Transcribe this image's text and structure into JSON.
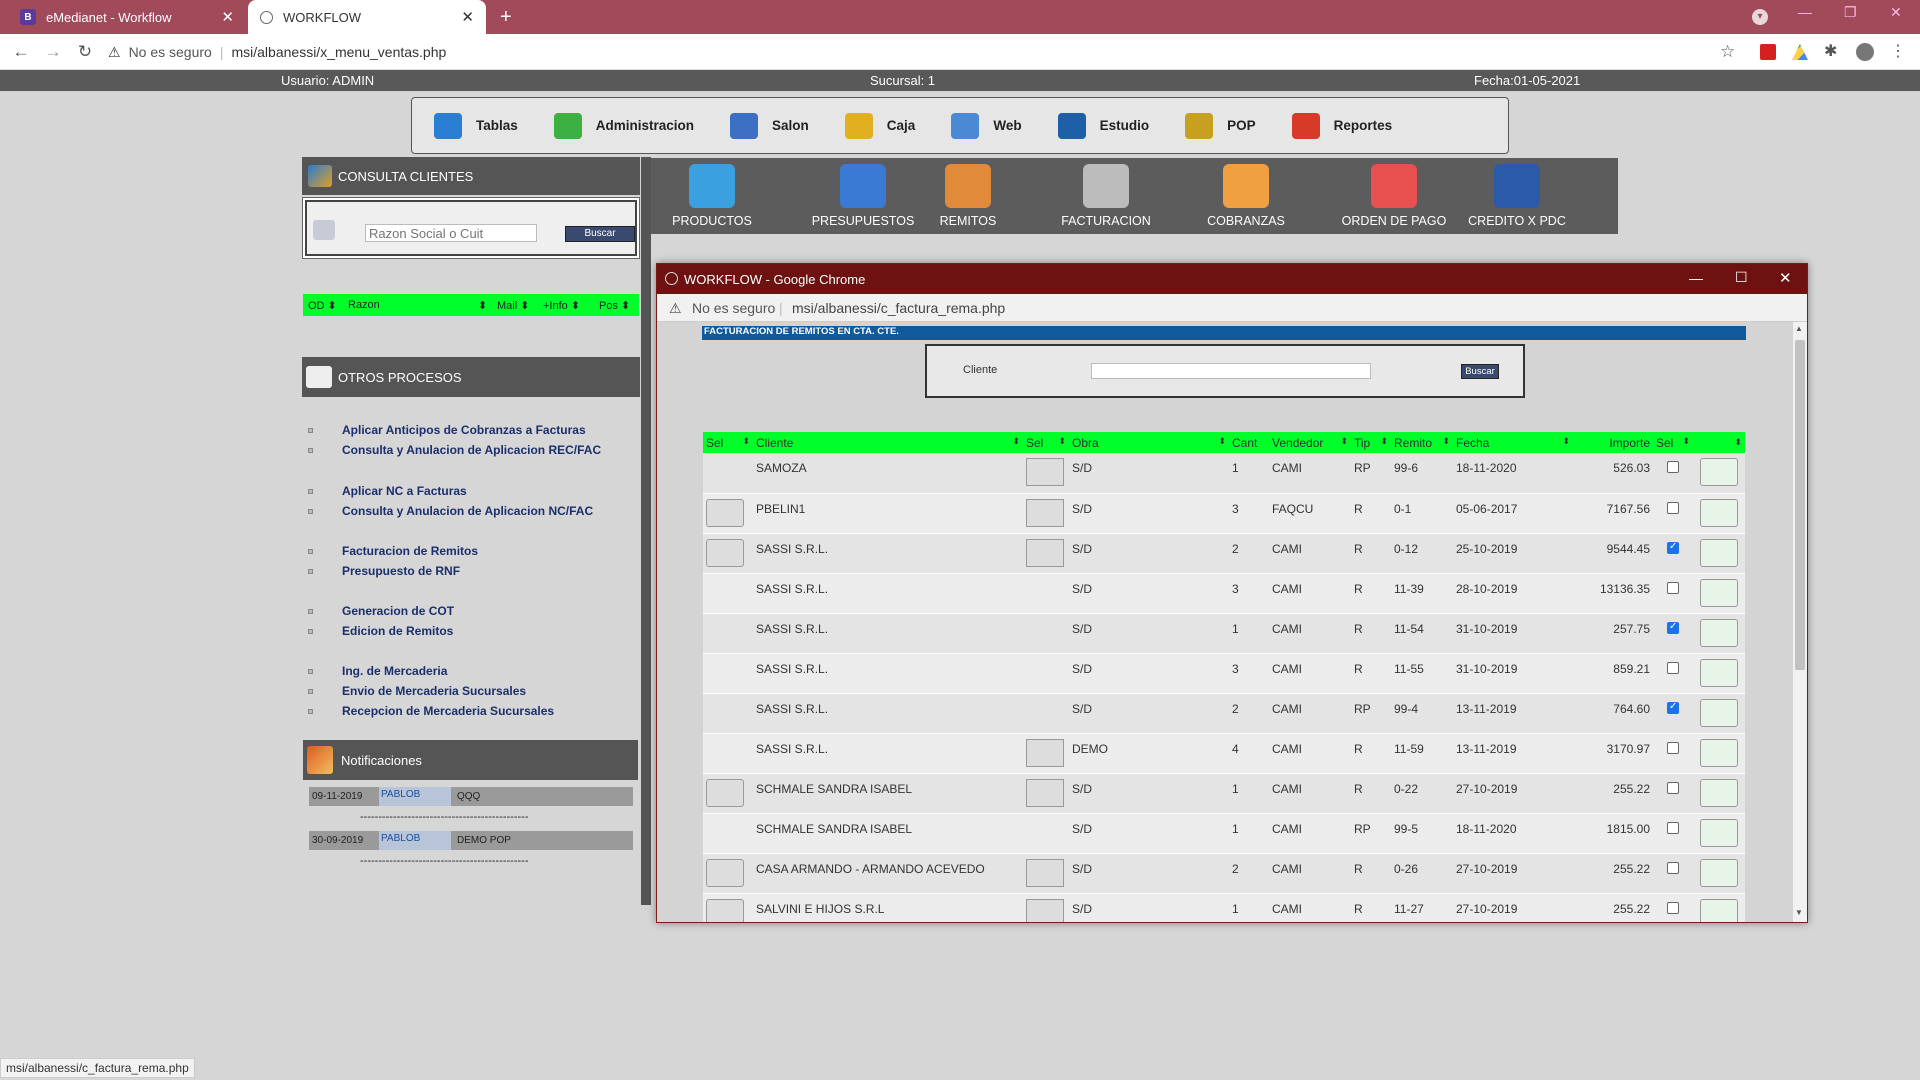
{
  "browser": {
    "tabs": [
      {
        "label": "eMedianet - Workflow",
        "favicon": "B"
      },
      {
        "label": "WORKFLOW"
      }
    ],
    "security": "No es seguro",
    "url": "msi/albanessi/x_menu_ventas.php"
  },
  "header": {
    "usuario": "Usuario: ADMIN",
    "sucursal": "Sucursal: 1",
    "fecha": "Fecha:01-05-2021"
  },
  "menu": [
    {
      "label": "Tablas",
      "icon": "table-icon",
      "color": "#2a7fd4"
    },
    {
      "label": "Administracion",
      "icon": "checklist-icon",
      "color": "#3cb043"
    },
    {
      "label": "Salon",
      "icon": "globe-icon",
      "color": "#3a6fc4"
    },
    {
      "label": "Caja",
      "icon": "cashbox-icon",
      "color": "#e0b020"
    },
    {
      "label": "Web",
      "icon": "search-people-icon",
      "color": "#4a8ad4"
    },
    {
      "label": "Estudio",
      "icon": "book-icon",
      "color": "#1f5fa8"
    },
    {
      "label": "POP",
      "icon": "users-chart-icon",
      "color": "#c8a020"
    },
    {
      "label": "Reportes",
      "icon": "pie-chart-icon",
      "color": "#d83a2a"
    }
  ],
  "consulta": {
    "title": "CONSULTA CLIENTES",
    "placeholder": "Razon Social o Cuit",
    "buscar": "Buscar",
    "columns": [
      "OD",
      "Razon",
      "Mail",
      "+Info",
      "Pos"
    ]
  },
  "otros": {
    "title": "OTROS PROCESOS",
    "groups": [
      [
        "Aplicar Anticipos de Cobranzas a Facturas",
        "Consulta y Anulacion de Aplicacion REC/FAC"
      ],
      [
        "Aplicar NC a Facturas",
        "Consulta y Anulacion de Aplicacion NC/FAC"
      ],
      [
        "Facturacion de Remitos",
        "Presupuesto de RNF"
      ],
      [
        "Generacion de COT",
        "Edicion de Remitos"
      ],
      [
        "Ing. de Mercaderia",
        "Envio de Mercaderia Sucursales",
        "Recepcion de Mercaderia Sucursales"
      ]
    ]
  },
  "notificaciones": {
    "title": "Notificaciones",
    "items": [
      {
        "fecha": "09-11-2019",
        "user": "PABLOB",
        "msg": "QQQ"
      },
      {
        "fecha": "30-09-2019",
        "user": "PABLOB",
        "msg": "DEMO POP"
      }
    ],
    "separator": "----------------------------------------------"
  },
  "toolbar": [
    {
      "label": "PRODUCTOS",
      "color": "#3aa0e0"
    },
    {
      "label": "PRESUPUESTOS",
      "color": "#3a7ad4"
    },
    {
      "label": "REMITOS",
      "color": "#e08a3a"
    },
    {
      "label": "FACTURACION",
      "color": "#bcbcbc"
    },
    {
      "label": "COBRANZAS",
      "color": "#f0a040"
    },
    {
      "label": "ORDEN DE PAGO",
      "color": "#e85050"
    },
    {
      "label": "CREDITO X PDC",
      "color": "#2a5aa8"
    }
  ],
  "popup": {
    "title": "WORKFLOW - Google Chrome",
    "security": "No es seguro",
    "url": "msi/albanessi/c_factura_rema.php",
    "banner": "FACTURACION DE REMITOS EN CTA. CTE.",
    "cliente_label": "Cliente",
    "buscar": "Buscar",
    "columns": [
      "Sel",
      "Cliente",
      "Sel",
      "Obra",
      "Cant",
      "Vendedor",
      "Tip",
      "Remito",
      "Fecha",
      "Importe",
      "Sel",
      ""
    ],
    "rows": [
      {
        "btn1": false,
        "cliente": "SAMOZA",
        "btn2": true,
        "obra": "S/D",
        "cant": "1",
        "vendedor": "CAMI",
        "tip": "RP",
        "remito": "99-6",
        "fecha": "18-11-2020",
        "importe": "526.03",
        "checked": false
      },
      {
        "btn1": true,
        "cliente": "PBELIN1",
        "btn2": true,
        "obra": "S/D",
        "cant": "3",
        "vendedor": "FAQCU",
        "tip": "R",
        "remito": "0-1",
        "fecha": "05-06-2017",
        "importe": "7167.56",
        "checked": false
      },
      {
        "btn1": true,
        "cliente": "SASSI S.R.L.",
        "btn2": true,
        "obra": "S/D",
        "cant": "2",
        "vendedor": "CAMI",
        "tip": "R",
        "remito": "0-12",
        "fecha": "25-10-2019",
        "importe": "9544.45",
        "checked": true
      },
      {
        "btn1": false,
        "cliente": "SASSI S.R.L.",
        "btn2": false,
        "obra": "S/D",
        "cant": "3",
        "vendedor": "CAMI",
        "tip": "R",
        "remito": "11-39",
        "fecha": "28-10-2019",
        "importe": "13136.35",
        "checked": false
      },
      {
        "btn1": false,
        "cliente": "SASSI S.R.L.",
        "btn2": false,
        "obra": "S/D",
        "cant": "1",
        "vendedor": "CAMI",
        "tip": "R",
        "remito": "11-54",
        "fecha": "31-10-2019",
        "importe": "257.75",
        "checked": true
      },
      {
        "btn1": false,
        "cliente": "SASSI S.R.L.",
        "btn2": false,
        "obra": "S/D",
        "cant": "3",
        "vendedor": "CAMI",
        "tip": "R",
        "remito": "11-55",
        "fecha": "31-10-2019",
        "importe": "859.21",
        "checked": false
      },
      {
        "btn1": false,
        "cliente": "SASSI S.R.L.",
        "btn2": false,
        "obra": "S/D",
        "cant": "2",
        "vendedor": "CAMI",
        "tip": "RP",
        "remito": "99-4",
        "fecha": "13-11-2019",
        "importe": "764.60",
        "checked": true
      },
      {
        "btn1": false,
        "cliente": "SASSI S.R.L.",
        "btn2": true,
        "obra": "DEMO",
        "cant": "4",
        "vendedor": "CAMI",
        "tip": "R",
        "remito": "11-59",
        "fecha": "13-11-2019",
        "importe": "3170.97",
        "checked": false
      },
      {
        "btn1": true,
        "cliente": "SCHMALE SANDRA ISABEL",
        "btn2": true,
        "obra": "S/D",
        "cant": "1",
        "vendedor": "CAMI",
        "tip": "R",
        "remito": "0-22",
        "fecha": "27-10-2019",
        "importe": "255.22",
        "checked": false
      },
      {
        "btn1": false,
        "cliente": "SCHMALE SANDRA ISABEL",
        "btn2": false,
        "obra": "S/D",
        "cant": "1",
        "vendedor": "CAMI",
        "tip": "RP",
        "remito": "99-5",
        "fecha": "18-11-2020",
        "importe": "1815.00",
        "checked": false
      },
      {
        "btn1": true,
        "cliente": "CASA ARMANDO - ARMANDO ACEVEDO",
        "btn2": true,
        "obra": "S/D",
        "cant": "2",
        "vendedor": "CAMI",
        "tip": "R",
        "remito": "0-26",
        "fecha": "27-10-2019",
        "importe": "255.22",
        "checked": false
      },
      {
        "btn1": true,
        "cliente": "SALVINI E HIJOS S.R.L",
        "btn2": true,
        "obra": "S/D",
        "cant": "1",
        "vendedor": "CAMI",
        "tip": "R",
        "remito": "11-27",
        "fecha": "27-10-2019",
        "importe": "255.22",
        "checked": false
      }
    ]
  },
  "status_url": "msi/albanessi/c_factura_rema.php"
}
